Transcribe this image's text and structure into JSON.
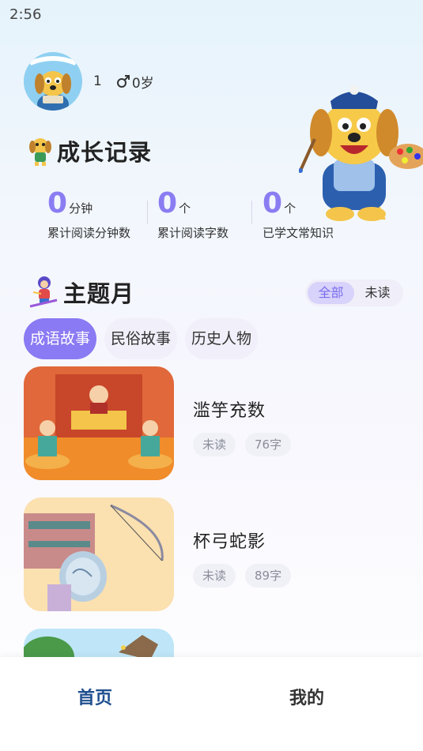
{
  "status_bar": {
    "time": "2:56"
  },
  "profile": {
    "name": "1",
    "gender_age": "0岁"
  },
  "growth": {
    "title": "成长记录",
    "stats": [
      {
        "value": "0",
        "unit": "分钟",
        "label": "累计阅读分钟数"
      },
      {
        "value": "0",
        "unit": "个",
        "label": "累计阅读字数"
      },
      {
        "value": "0",
        "unit": "个",
        "label": "已学文常知识"
      }
    ]
  },
  "theme": {
    "title": "主题月",
    "filter": {
      "all": "全部",
      "unread": "未读",
      "selected": "全部"
    },
    "tabs": [
      {
        "label": "成语故事",
        "active": true
      },
      {
        "label": "民俗故事",
        "active": false
      },
      {
        "label": "历史人物",
        "active": false
      }
    ]
  },
  "stories": [
    {
      "title": "滥竽充数",
      "status": "未读",
      "words": "76字"
    },
    {
      "title": "杯弓蛇影",
      "status": "未读",
      "words": "89字"
    }
  ],
  "nav": {
    "home": "首页",
    "mine": "我的"
  },
  "colors": {
    "accent": "#8a7af3",
    "nav_active": "#1f4f8f"
  }
}
